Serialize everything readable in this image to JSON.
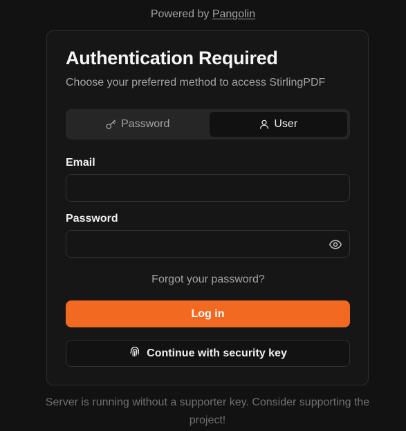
{
  "header": {
    "powered_prefix": "Powered by",
    "powered_link": "Pangolin"
  },
  "card": {
    "title": "Authentication Required",
    "subtitle": "Choose your preferred method to access StirlingPDF",
    "tabs": [
      {
        "label": "Password",
        "icon": "key-icon",
        "active": false
      },
      {
        "label": "User",
        "icon": "user-icon",
        "active": true
      }
    ],
    "email_label": "Email",
    "email_value": "",
    "password_label": "Password",
    "password_value": "",
    "forgot_link": "Forgot your password?",
    "login_button": "Log in",
    "security_key_button": "Continue with security key"
  },
  "footer": {
    "text": "Server is running without a supporter key. Consider supporting the project!"
  },
  "colors": {
    "accent": "#f26a22",
    "background": "#121212",
    "card": "#161616"
  }
}
